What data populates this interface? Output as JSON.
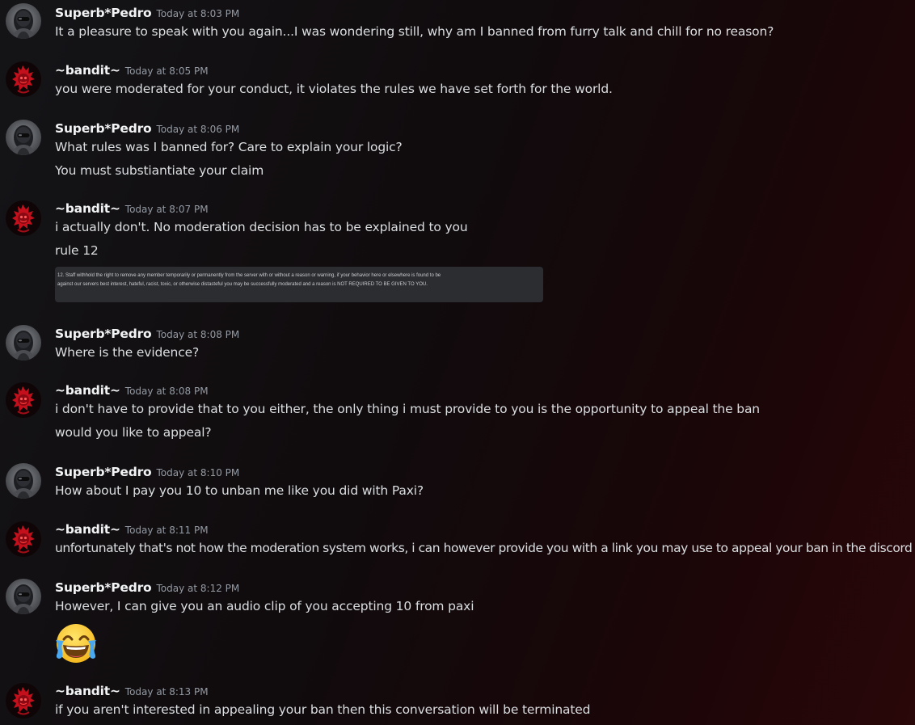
{
  "messages": [
    {
      "author": "Superb*Pedro",
      "timestamp": "Today at 8:03 PM",
      "avatar_icon": "robot-avatar-icon",
      "lines": [
        "It a pleasure to speak with you again...I was wondering still, why am I banned from furry talk and chill for no reason?"
      ]
    },
    {
      "author": "~bandit~",
      "timestamp": "Today at 8:05 PM",
      "avatar_icon": "red-dragon-avatar-icon",
      "lines": [
        "you were moderated for your conduct, it violates the rules we have set forth for the world."
      ]
    },
    {
      "author": "Superb*Pedro",
      "timestamp": "Today at 8:06 PM",
      "avatar_icon": "robot-avatar-icon",
      "lines": [
        "What rules was I banned for? Care to explain your logic?",
        "You must substiantiate your claim"
      ]
    },
    {
      "author": "~bandit~",
      "timestamp": "Today at 8:07 PM",
      "avatar_icon": "red-dragon-avatar-icon",
      "lines": [
        "i actually don't. No moderation decision has to be explained to you",
        "rule 12"
      ],
      "embed": {
        "line1": "12. Staff withhold the right to remove any member temporarily or permanently from the server with or without a reason or warning, if your behavior here or elsewhere is found to be",
        "line2": "against our servers best interest, hateful, racist, toxic, or otherwise distasteful you may be successfully moderated and a reason is NOT REQUIRED TO BE GIVEN TO YOU."
      }
    },
    {
      "author": "Superb*Pedro",
      "timestamp": "Today at 8:08 PM",
      "avatar_icon": "robot-avatar-icon",
      "lines": [
        "Where is the evidence?"
      ]
    },
    {
      "author": "~bandit~",
      "timestamp": "Today at 8:08 PM",
      "avatar_icon": "red-dragon-avatar-icon",
      "lines": [
        "i don't have to provide that to you either, the only thing i must provide to you is the opportunity to appeal the ban",
        "would you like to appeal?"
      ]
    },
    {
      "author": "Superb*Pedro",
      "timestamp": "Today at 8:10 PM",
      "avatar_icon": "robot-avatar-icon",
      "lines": [
        "How about I pay you 10 to unban me like you did with Paxi?"
      ]
    },
    {
      "author": "~bandit~",
      "timestamp": "Today at 8:11 PM",
      "avatar_icon": "red-dragon-avatar-icon",
      "lines": [
        "unfortunately that's not how the moderation system works, i can however provide you with a link you may use to appeal your ban in the discord"
      ]
    },
    {
      "author": "Superb*Pedro",
      "timestamp": "Today at 8:12 PM",
      "avatar_icon": "robot-avatar-icon",
      "lines": [
        "However, I can give you an audio clip of you accepting 10 from paxi"
      ],
      "emoji": "tears-of-joy-emoji-icon"
    },
    {
      "author": "~bandit~",
      "timestamp": "Today at 8:13 PM",
      "avatar_icon": "red-dragon-avatar-icon",
      "lines": [
        "if you aren't interested in appealing your ban then this conversation will be terminated"
      ]
    }
  ]
}
